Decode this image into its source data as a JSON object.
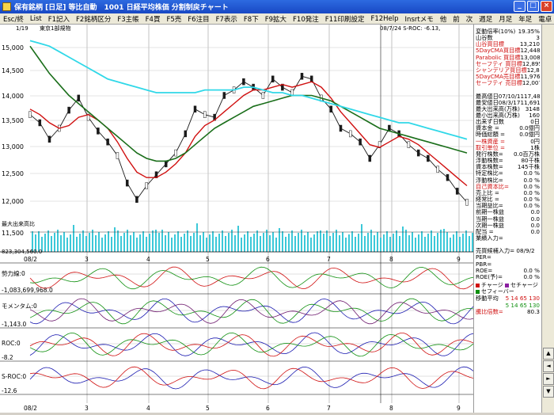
{
  "window": {
    "title": "保有銘柄 [日足] 等比自動　1001 日経平均株価 分割制戻チャート",
    "minimize": "_",
    "maximize": "□",
    "close": "×"
  },
  "menu": [
    "Esc/終",
    "List",
    "F1記入",
    "F2銘柄区分",
    "F3主帳",
    "F4買",
    "F5売",
    "F6注目",
    "F7表示",
    "F8下",
    "F9拡大",
    "F10発注",
    "F11印刷設定",
    "F12Help",
    "Insrtメモ",
    "他",
    "前",
    "次",
    "週足",
    "月足",
    "年足",
    "電卓"
  ],
  "chart": {
    "header_left": "1/19",
    "market_label": "東京1部規物",
    "header_right": "08/7/24 S-ROC: -6.13,",
    "price_ticks": [
      "15,000",
      "14,500",
      "14,000",
      "13,500",
      "13,000",
      "12,500",
      "12,000"
    ],
    "volume_label": "最大出来高比",
    "volume_tick": "11,500",
    "volume_value": "823,304,560.0",
    "month_labels_mid": [
      "08/2",
      "3",
      "4",
      "5",
      "6",
      "7",
      "8",
      "9"
    ],
    "month_labels_bottom": [
      "08/2",
      "3",
      "4",
      "5",
      "6",
      "7",
      "8",
      "9"
    ],
    "ind1": {
      "label": "勢力線:0",
      "low": "-1,083,699,968.0"
    },
    "ind2": {
      "label": "モメンタム:0",
      "low": "-1,143.0"
    },
    "ind3": {
      "label": "ROC:0",
      "low": "-8.2"
    },
    "ind4": {
      "label": "S-ROC:0",
      "low": "-12.6"
    }
  },
  "chart_data": {
    "type": "line",
    "title": "日経平均株価",
    "x_range": [
      "2008-01-19",
      "2008-09-12"
    ],
    "ylim": [
      11800,
      15200
    ],
    "series": [
      {
        "name": "price",
        "values": [
          13700,
          13550,
          13250,
          13450,
          13780,
          14000,
          13650,
          13400,
          13200,
          12950,
          12450,
          12150,
          12400,
          12600,
          12800,
          13000,
          13350,
          13800,
          13700,
          13650,
          14050,
          14150,
          14300,
          14200,
          14050,
          14350,
          14200,
          14100,
          14400,
          14350,
          14000,
          13800,
          13450,
          13350,
          13200,
          12900,
          13150,
          13450,
          13350,
          13150,
          13000,
          12900,
          12700,
          12550,
          12300,
          12100
        ]
      },
      {
        "name": "ma_short",
        "values": [
          13800,
          13700,
          13550,
          13450,
          13500,
          13650,
          13700,
          13600,
          13450,
          13200,
          12900,
          12650,
          12550,
          12550,
          12650,
          12800,
          13000,
          13300,
          13500,
          13600,
          13750,
          13900,
          14050,
          14150,
          14150,
          14200,
          14250,
          14200,
          14250,
          14300,
          14200,
          14000,
          13750,
          13550,
          13350,
          13150,
          13100,
          13200,
          13300,
          13250,
          13150,
          13000,
          12850,
          12700,
          12550,
          12400
        ]
      },
      {
        "name": "ma_mid",
        "values": [
          14950,
          14700,
          14450,
          14250,
          14050,
          13900,
          13750,
          13600,
          13450,
          13300,
          13150,
          13000,
          12900,
          12850,
          12850,
          12900,
          13000,
          13150,
          13300,
          13450,
          13550,
          13650,
          13750,
          13850,
          13900,
          13950,
          14000,
          14050,
          14050,
          14050,
          14000,
          13950,
          13850,
          13750,
          13650,
          13550,
          13450,
          13400,
          13350,
          13300,
          13250,
          13200,
          13150,
          13100,
          13050,
          13000
        ]
      },
      {
        "name": "ma_long",
        "values": [
          15050,
          15000,
          14950,
          14850,
          14750,
          14650,
          14550,
          14450,
          14350,
          14300,
          14250,
          14200,
          14150,
          14100,
          14100,
          14100,
          14100,
          14100,
          14150,
          14150,
          14150,
          14150,
          14200,
          14200,
          14150,
          14100,
          14100,
          14050,
          14050,
          14000,
          13950,
          13900,
          13850,
          13800,
          13750,
          13700,
          13650,
          13600,
          13550,
          13550,
          13500,
          13450,
          13400,
          13350,
          13300,
          13250
        ]
      }
    ]
  },
  "info": {
    "rows": [
      {
        "l": "変動倍率(10%)",
        "v": "19.35%",
        "red": false
      },
      {
        "l": "山谷数",
        "v": "3",
        "red": false
      },
      {
        "l": "山谷買目標",
        "v": "13,210",
        "red": true
      },
      {
        "l": "5DayCMA買目標",
        "v": "12,448",
        "red": true
      },
      {
        "l": "Parabolic 買目標",
        "v": "13,008",
        "red": true
      },
      {
        "l": "セーフティ 買目標",
        "v": "12,895",
        "red": true
      },
      {
        "l": "シャンデリア買目標",
        "v": "12,869",
        "red": true
      },
      {
        "l": "5DayCMA売目標",
        "v": "11,976",
        "red": true
      },
      {
        "l": "セーフティ 売目標",
        "v": "12,007",
        "red": true
      },
      {
        "l": "",
        "v": "",
        "red": false
      },
      {
        "l": "最高値日07/10/11",
        "v": "17,488",
        "red": false
      },
      {
        "l": "最安値日08/3/17",
        "v": "11,691",
        "red": false
      },
      {
        "l": "最大出来高(万株)",
        "v": "3148",
        "red": false
      },
      {
        "l": "最小出来高(万株)",
        "v": "160",
        "red": false
      },
      {
        "l": "出来ず日数",
        "v": "0日",
        "red": false
      },
      {
        "l": "資本金 =",
        "v": "0.0億円",
        "red": false
      },
      {
        "l": "時価総額 =",
        "v": "0.0億円",
        "red": false
      },
      {
        "l": "一株資産 =",
        "v": "0円",
        "red": true
      },
      {
        "l": "取引単位 =",
        "v": "1株",
        "red": true
      },
      {
        "l": "発行株数=",
        "v": "0.0百万株",
        "red": false
      },
      {
        "l": "浮動株数=",
        "v": "80千株",
        "red": false
      },
      {
        "l": "資本株数=",
        "v": "145千株",
        "red": false
      },
      {
        "l": "特定株比=",
        "v": "0.0 %",
        "red": false
      },
      {
        "l": "浮動株比=",
        "v": "0.0 %",
        "red": false
      },
      {
        "l": "自己資本比=",
        "v": "0.0 %",
        "red": true
      },
      {
        "l": "売上比 =",
        "v": "0.0 %",
        "red": false
      },
      {
        "l": "経常比 =",
        "v": "0.0 %",
        "red": false
      },
      {
        "l": "当期益比=",
        "v": "0.0 %",
        "red": false
      },
      {
        "l": "前期一株益",
        "v": "0.0",
        "red": false
      },
      {
        "l": "当期一株益",
        "v": "0.0",
        "red": false
      },
      {
        "l": "次期一株益",
        "v": "0.0",
        "red": false
      },
      {
        "l": "配当 =",
        "v": "0.0",
        "red": false
      },
      {
        "l": "業績入力=",
        "v": "",
        "red": false
      },
      {
        "l": "",
        "v": "",
        "red": false
      },
      {
        "l": "売買候補入力= 08/9/2",
        "v": "",
        "red": false
      },
      {
        "l": "PER=",
        "v": "",
        "red": false
      },
      {
        "l": "PBR=",
        "v": "",
        "red": false
      },
      {
        "l": "ROE=",
        "v": "0.0 %",
        "red": false
      },
      {
        "l": "ROE(予)=",
        "v": "0.0 %",
        "red": false
      }
    ],
    "legend": [
      {
        "label": "チャージ",
        "color": "#d01010"
      },
      {
        "label": "セチャージ",
        "color": "#8a1ea0"
      },
      {
        "label": "セフィーバー",
        "color": "#109010"
      }
    ],
    "ma_label": "移動平均",
    "ma_values": "5  14 65 130",
    "ma_values2": "5  14 65 130",
    "ratio_label": "騰比倍数=",
    "ratio_value": "80.3"
  },
  "scroll": {
    "up": "▲",
    "left": "◄",
    "right": "►",
    "down": "▼"
  }
}
